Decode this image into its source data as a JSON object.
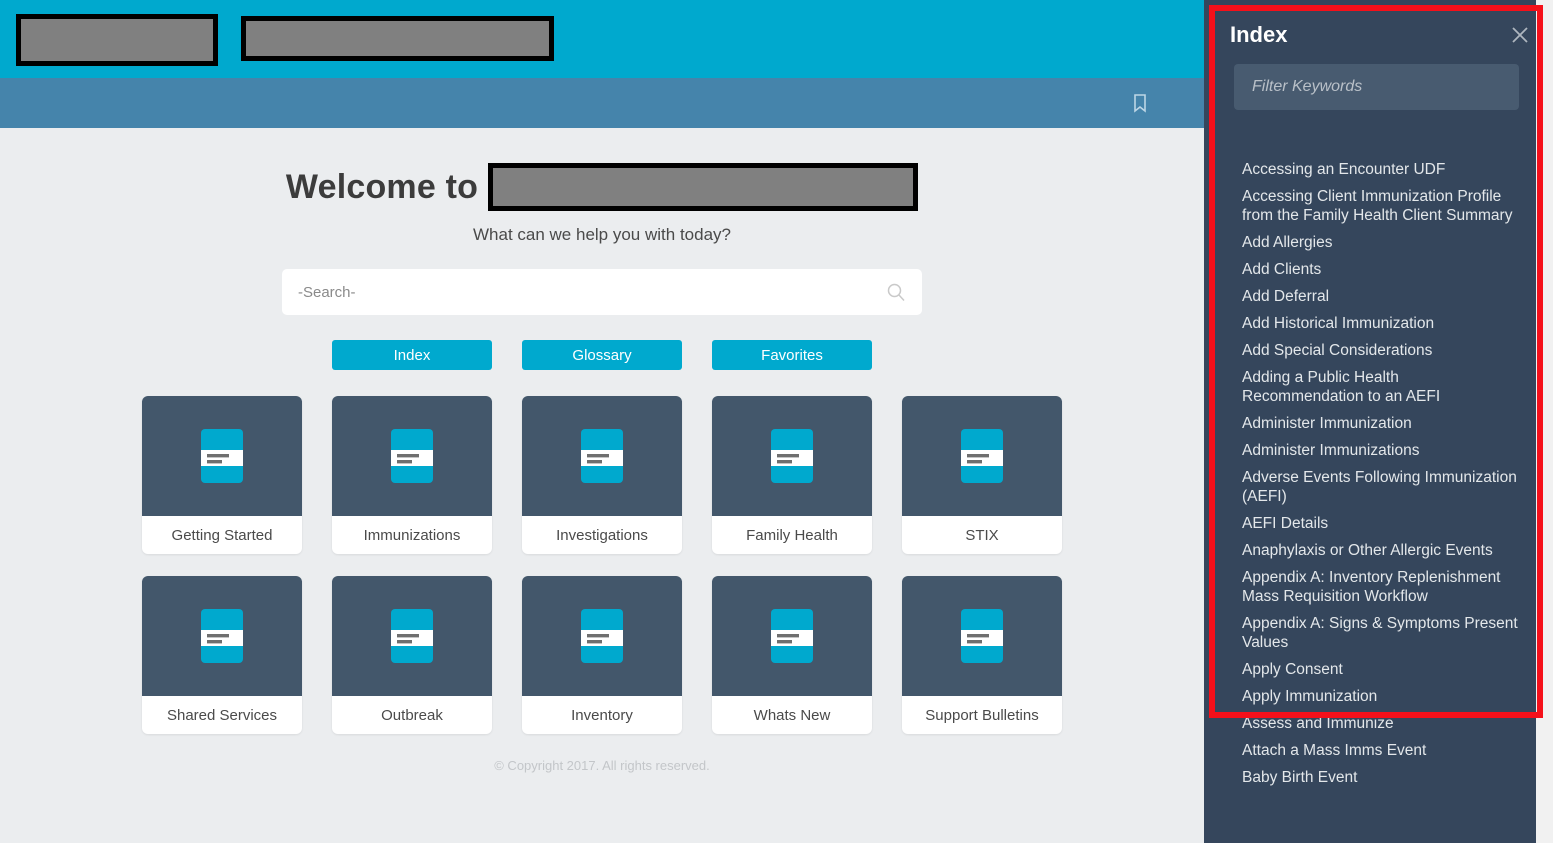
{
  "topbar": {
    "logo_redacted": "redacted-logo-block",
    "brand_redacted": "redacted-brand-block"
  },
  "subbar": {
    "bookmark_icon": "bookmark-icon"
  },
  "welcome": {
    "prefix": "Welcome to",
    "appname_redacted": "redacted-app-name-block",
    "subtitle": "What can we help you with today?"
  },
  "search": {
    "placeholder": "-Search-",
    "value": "",
    "icon": "search-icon"
  },
  "buttons": [
    {
      "label": "Index"
    },
    {
      "label": "Glossary"
    },
    {
      "label": "Favorites"
    }
  ],
  "tiles": [
    [
      {
        "label": "Getting Started"
      },
      {
        "label": "Immunizations"
      },
      {
        "label": "Investigations"
      },
      {
        "label": "Family Health"
      },
      {
        "label": "STIX"
      }
    ],
    [
      {
        "label": "Shared Services"
      },
      {
        "label": "Outbreak"
      },
      {
        "label": "Inventory"
      },
      {
        "label": "Whats New"
      },
      {
        "label": "Support Bulletins"
      }
    ]
  ],
  "footer": {
    "copyright": "© Copyright 2017. All rights reserved."
  },
  "index_panel": {
    "title": "Index",
    "close_icon": "close-icon",
    "filter": {
      "placeholder": "Filter Keywords",
      "value": ""
    },
    "items": [
      "Accessing an Encounter UDF",
      "Accessing Client Immunization Profile from the Family Health Client Summary",
      "Add Allergies",
      "Add Clients",
      "Add Deferral",
      "Add Historical Immunization",
      "Add Special Considerations",
      "Adding a Public Health Recommendation to an AEFI",
      "Administer Immunization",
      "Administer Immunizations",
      "Adverse Events Following Immunization (AEFI)",
      "AEFI Details",
      "Anaphylaxis or Other Allergic Events",
      "Appendix A: Inventory Replenishment Mass Requisition Workflow",
      "Appendix A: Signs & Symptoms Present Values",
      "Apply Consent",
      "Apply Immunization",
      "Assess and Immunize",
      "Attach a Mass Imms Event",
      "Baby Birth Event"
    ]
  },
  "colors": {
    "topbar": "#00a9ce",
    "subbar": "#4584ab",
    "page_bg": "#ebedef",
    "panel_bg": "#35465c",
    "tile_head": "#43576b",
    "accent": "#00a9ce",
    "highlight": "#f5101a"
  }
}
